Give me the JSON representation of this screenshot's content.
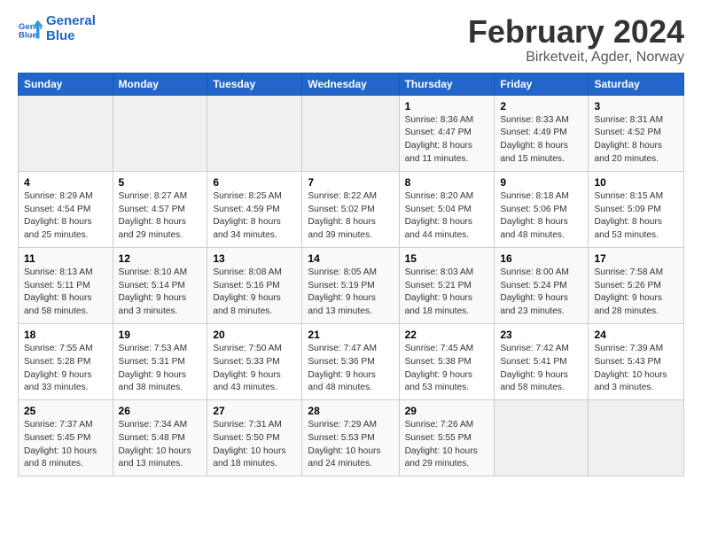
{
  "header": {
    "logo_line1": "General",
    "logo_line2": "Blue",
    "month": "February 2024",
    "location": "Birketveit, Agder, Norway"
  },
  "weekdays": [
    "Sunday",
    "Monday",
    "Tuesday",
    "Wednesday",
    "Thursday",
    "Friday",
    "Saturday"
  ],
  "weeks": [
    [
      {
        "day": "",
        "detail": ""
      },
      {
        "day": "",
        "detail": ""
      },
      {
        "day": "",
        "detail": ""
      },
      {
        "day": "",
        "detail": ""
      },
      {
        "day": "1",
        "detail": "Sunrise: 8:36 AM\nSunset: 4:47 PM\nDaylight: 8 hours and 11 minutes."
      },
      {
        "day": "2",
        "detail": "Sunrise: 8:33 AM\nSunset: 4:49 PM\nDaylight: 8 hours and 15 minutes."
      },
      {
        "day": "3",
        "detail": "Sunrise: 8:31 AM\nSunset: 4:52 PM\nDaylight: 8 hours and 20 minutes."
      }
    ],
    [
      {
        "day": "4",
        "detail": "Sunrise: 8:29 AM\nSunset: 4:54 PM\nDaylight: 8 hours and 25 minutes."
      },
      {
        "day": "5",
        "detail": "Sunrise: 8:27 AM\nSunset: 4:57 PM\nDaylight: 8 hours and 29 minutes."
      },
      {
        "day": "6",
        "detail": "Sunrise: 8:25 AM\nSunset: 4:59 PM\nDaylight: 8 hours and 34 minutes."
      },
      {
        "day": "7",
        "detail": "Sunrise: 8:22 AM\nSunset: 5:02 PM\nDaylight: 8 hours and 39 minutes."
      },
      {
        "day": "8",
        "detail": "Sunrise: 8:20 AM\nSunset: 5:04 PM\nDaylight: 8 hours and 44 minutes."
      },
      {
        "day": "9",
        "detail": "Sunrise: 8:18 AM\nSunset: 5:06 PM\nDaylight: 8 hours and 48 minutes."
      },
      {
        "day": "10",
        "detail": "Sunrise: 8:15 AM\nSunset: 5:09 PM\nDaylight: 8 hours and 53 minutes."
      }
    ],
    [
      {
        "day": "11",
        "detail": "Sunrise: 8:13 AM\nSunset: 5:11 PM\nDaylight: 8 hours and 58 minutes."
      },
      {
        "day": "12",
        "detail": "Sunrise: 8:10 AM\nSunset: 5:14 PM\nDaylight: 9 hours and 3 minutes."
      },
      {
        "day": "13",
        "detail": "Sunrise: 8:08 AM\nSunset: 5:16 PM\nDaylight: 9 hours and 8 minutes."
      },
      {
        "day": "14",
        "detail": "Sunrise: 8:05 AM\nSunset: 5:19 PM\nDaylight: 9 hours and 13 minutes."
      },
      {
        "day": "15",
        "detail": "Sunrise: 8:03 AM\nSunset: 5:21 PM\nDaylight: 9 hours and 18 minutes."
      },
      {
        "day": "16",
        "detail": "Sunrise: 8:00 AM\nSunset: 5:24 PM\nDaylight: 9 hours and 23 minutes."
      },
      {
        "day": "17",
        "detail": "Sunrise: 7:58 AM\nSunset: 5:26 PM\nDaylight: 9 hours and 28 minutes."
      }
    ],
    [
      {
        "day": "18",
        "detail": "Sunrise: 7:55 AM\nSunset: 5:28 PM\nDaylight: 9 hours and 33 minutes."
      },
      {
        "day": "19",
        "detail": "Sunrise: 7:53 AM\nSunset: 5:31 PM\nDaylight: 9 hours and 38 minutes."
      },
      {
        "day": "20",
        "detail": "Sunrise: 7:50 AM\nSunset: 5:33 PM\nDaylight: 9 hours and 43 minutes."
      },
      {
        "day": "21",
        "detail": "Sunrise: 7:47 AM\nSunset: 5:36 PM\nDaylight: 9 hours and 48 minutes."
      },
      {
        "day": "22",
        "detail": "Sunrise: 7:45 AM\nSunset: 5:38 PM\nDaylight: 9 hours and 53 minutes."
      },
      {
        "day": "23",
        "detail": "Sunrise: 7:42 AM\nSunset: 5:41 PM\nDaylight: 9 hours and 58 minutes."
      },
      {
        "day": "24",
        "detail": "Sunrise: 7:39 AM\nSunset: 5:43 PM\nDaylight: 10 hours and 3 minutes."
      }
    ],
    [
      {
        "day": "25",
        "detail": "Sunrise: 7:37 AM\nSunset: 5:45 PM\nDaylight: 10 hours and 8 minutes."
      },
      {
        "day": "26",
        "detail": "Sunrise: 7:34 AM\nSunset: 5:48 PM\nDaylight: 10 hours and 13 minutes."
      },
      {
        "day": "27",
        "detail": "Sunrise: 7:31 AM\nSunset: 5:50 PM\nDaylight: 10 hours and 18 minutes."
      },
      {
        "day": "28",
        "detail": "Sunrise: 7:29 AM\nSunset: 5:53 PM\nDaylight: 10 hours and 24 minutes."
      },
      {
        "day": "29",
        "detail": "Sunrise: 7:26 AM\nSunset: 5:55 PM\nDaylight: 10 hours and 29 minutes."
      },
      {
        "day": "",
        "detail": ""
      },
      {
        "day": "",
        "detail": ""
      }
    ]
  ]
}
